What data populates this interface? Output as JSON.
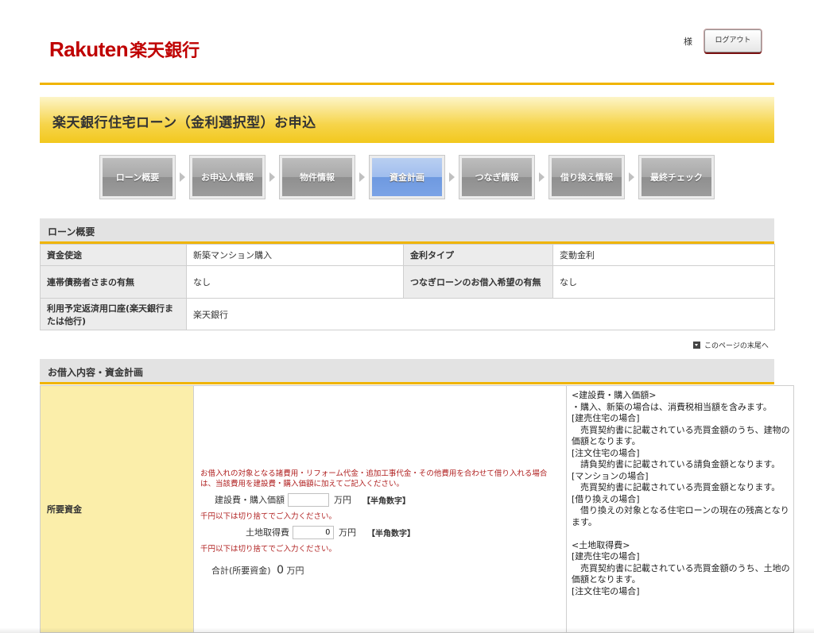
{
  "header": {
    "logo_en": "Rakuten",
    "logo_jp": "楽天銀行",
    "honorific": "様",
    "logout_label": "ログアウト"
  },
  "title": "楽天銀行住宅ローン（金利選択型）お申込",
  "steps": [
    {
      "label": "ローン概要",
      "active": false
    },
    {
      "label": "お申込人情報",
      "active": false
    },
    {
      "label": "物件情報",
      "active": false
    },
    {
      "label": "資金計画",
      "active": true
    },
    {
      "label": "つなぎ情報",
      "active": false
    },
    {
      "label": "借り換え情報",
      "active": false
    },
    {
      "label": "最終チェック",
      "active": false
    }
  ],
  "summary": {
    "heading": "ローン概要",
    "rows": [
      {
        "label1": "資金使途",
        "value1": "新築マンション購入",
        "label2": "金利タイプ",
        "value2": "変動金利"
      },
      {
        "label1": "連帯債務者さまの有無",
        "value1": "なし",
        "label2": "つなぎローンのお借入希望の有無",
        "value2": "なし"
      },
      {
        "label1": "利用予定返済用口座(楽天銀行または他行)",
        "value1": "楽天銀行"
      }
    ]
  },
  "page_end_link": "このページの末尾へ",
  "loan": {
    "heading": "お借入内容・資金計画",
    "row_label": "所要資金",
    "note_red": "お借入れの対象となる諸費用・リフォーム代金・追加工事代金・その他費用を合わせて借り入れる場合は、当該費用を建設費・購入価額に加えてご記入ください。",
    "construction_label": "建設費・購入価額",
    "construction_value": "",
    "land_label": "土地取得費",
    "land_value": "0",
    "unit": "万円",
    "hint": "【半角数字】",
    "round_note": "千円以下は切り捨てでご入力ください。",
    "total_label": "合計(所要資金)",
    "total_value": "0",
    "total_unit": "万円",
    "help": [
      "<建設費・購入価額>",
      "・購入、新築の場合は、消費税相当額を含みます。",
      "[建売住宅の場合]",
      "　売買契約書に記載されている売買金額のうち、建物の価額となります。",
      "[注文住宅の場合]",
      "　請負契約書に記載されている請負金額となります。",
      "[マンションの場合]",
      "　売買契約書に記載されている売買金額となります。",
      "[借り換えの場合]",
      "　借り換えの対象となる住宅ローンの現在の残高となります。",
      "",
      "<土地取得費>",
      "[建売住宅の場合]",
      "　売買契約書に記載されている売買金額のうち、土地の価額となります。",
      "[注文住宅の場合]"
    ]
  }
}
